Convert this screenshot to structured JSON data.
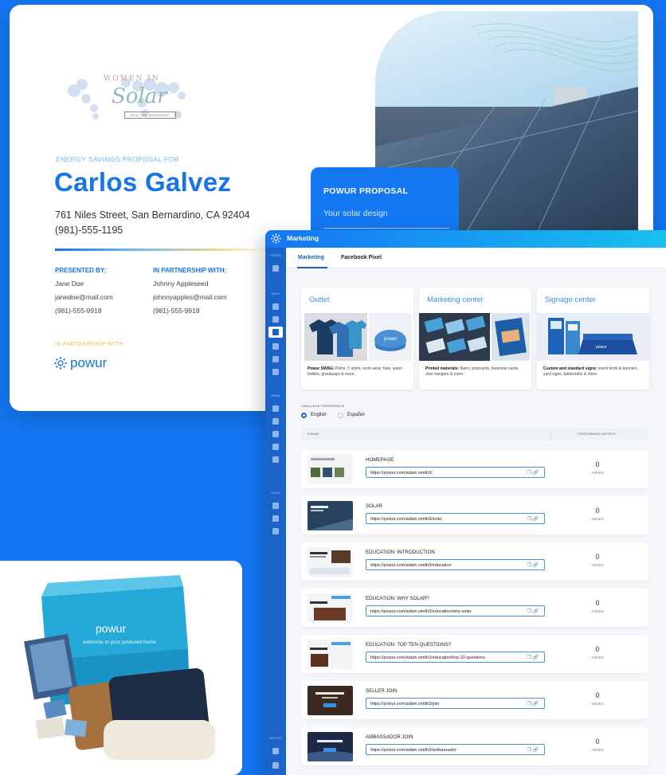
{
  "proposal": {
    "brand_logo": {
      "top_text": "WOMEN IN",
      "main_text": "Solar",
      "tagline": "JOIN THE MOVEMENT"
    },
    "eyebrow": "ENERGY SAVINGS PROPOSAL FOR",
    "customer_name": "Carlos Galvez",
    "address": "761 Niles Street, San Bernardino, CA 92404",
    "phone": "(981)-555-1195",
    "presented_by": {
      "heading": "PRESENTED BY:",
      "name": "Jane Doe",
      "email": "janedoe@mail.com",
      "phone": "(981)-555-9918"
    },
    "partnership": {
      "heading": "IN PARTNERSHIP WITH:",
      "name": "Johnny Appleseed",
      "email": "johnnyapples@mail.com",
      "phone": "(981)-555-9918"
    },
    "partner_eyebrow": "IN PARTNERSHIP WITH",
    "partner_logo": "powur",
    "callout": {
      "title": "POWUR PROPOSAL",
      "subtitle": "Your solar design"
    }
  },
  "app": {
    "title": "Marketing",
    "sidebar_sections": [
      "POWUR",
      "SALES",
      "ADMIN",
      "LEARN",
      "SUPPORT"
    ],
    "tabs": [
      {
        "label": "Marketing",
        "active": true
      },
      {
        "label": "Facebook Pixel",
        "active": false
      }
    ],
    "cards": [
      {
        "title": "Outlet",
        "desc_bold": "Powur SWAG:",
        "desc": " Polos, T-shirts, work wear, hats, water bottles, giveaways & more."
      },
      {
        "title": "Marketing center",
        "desc_bold": "Printed materials:",
        "desc": " flyers, postcards, business cards, door hangers & more."
      },
      {
        "title": "Signage center",
        "desc_bold": "Custom and standard signs:",
        "desc": " event tents & banners, yard signs, tablecloths & more."
      }
    ],
    "language": {
      "label": "LANGUAGE PREFERENCE",
      "options": [
        "English",
        "Español"
      ],
      "selected": "English"
    },
    "funnel_header": {
      "left": "FUNNEL",
      "right": "PERFORMANCE METRICS"
    },
    "funnels": [
      {
        "name": "HOMEPAGE",
        "url": "https://powur.com/adam.smith3/",
        "views": "0",
        "views_label": "VIEWS"
      },
      {
        "name": "SOLAR",
        "url": "https://powur.com/adam.smith3/solar",
        "views": "0",
        "views_label": "VIEWS"
      },
      {
        "name": "EDUCATION: INTRODUCTION",
        "url": "https://powur.com/adam.smith3/education",
        "views": "0",
        "views_label": "VIEWS"
      },
      {
        "name": "EDUCATION: WHY SOLAR?",
        "url": "https://powur.com/adam.smith3/education/why-solar",
        "views": "0",
        "views_label": "VIEWS"
      },
      {
        "name": "EDUCATION: TOP TEN QUESTIONS?",
        "url": "https://powur.com/adam.smith3/education/top-10-questions",
        "views": "0",
        "views_label": "VIEWS"
      },
      {
        "name": "SELLER JOIN",
        "url": "https://powur.com/adam.smith3/join",
        "views": "0",
        "views_label": "VIEWS"
      },
      {
        "name": "AMBASSADOR JOIN",
        "url": "https://powur.com/adam.smith3/ambassador",
        "views": "0",
        "views_label": "VIEWS"
      }
    ]
  },
  "welcome_box": {
    "logo": "powur",
    "message": "welcome to your powured home"
  },
  "colors": {
    "background": "#1476f2",
    "brand_blue": "#1673e9",
    "accent_gold": "#f0b94b",
    "sidebar": "#1b63c9"
  }
}
